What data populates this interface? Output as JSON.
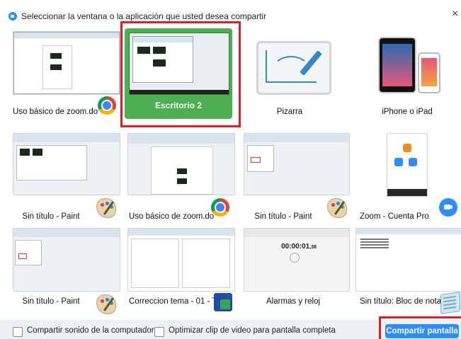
{
  "dialog": {
    "title": "Seleccionar la ventana o la aplicación que usted desea compartir",
    "close_icon": "close-icon"
  },
  "colors": {
    "accent": "#2D8CFF",
    "selected_tile": "#4CAF50",
    "highlight": "#e11d25"
  },
  "tiles": [
    {
      "label": "Uso básico de zoom.doc...",
      "badge": "chrome-icon"
    },
    {
      "label": "Escritorio 2",
      "selected": true
    },
    {
      "label": "Pizarra"
    },
    {
      "label": "iPhone o iPad"
    },
    {
      "label": "Sin título - Paint",
      "badge": "paint-icon"
    },
    {
      "label": "Uso básico de zoom.doc...",
      "badge": "chrome-icon"
    },
    {
      "label": "Sin título - Paint",
      "badge": "paint-icon"
    },
    {
      "label": "Zoom - Cuenta Pro",
      "badge": "zoom-icon"
    },
    {
      "label": "Sin título - Paint",
      "badge": "paint-icon"
    },
    {
      "label": "Correccion tema - 01 - T...",
      "badge": "remote-desktop-icon"
    },
    {
      "label": "Alarmas y reloj"
    },
    {
      "label": "Sin título: Bloc de notas",
      "badge": "notepad-icon"
    }
  ],
  "clock": {
    "time_main": "00:00:01",
    "time_ms": ",38"
  },
  "footer": {
    "share_sound_label": "Compartir sonido de la computadora",
    "optimize_video_label": "Optimizar clip de video para pantalla completa",
    "share_button_label": "Compartir pantalla"
  }
}
